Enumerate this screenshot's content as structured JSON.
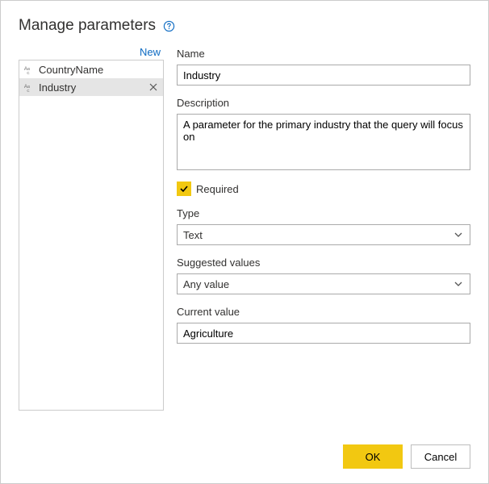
{
  "header": {
    "title": "Manage parameters"
  },
  "sidebar": {
    "new_label": "New",
    "items": [
      {
        "label": "CountryName",
        "selected": false
      },
      {
        "label": "Industry",
        "selected": true
      }
    ]
  },
  "form": {
    "name_label": "Name",
    "name_value": "Industry",
    "description_label": "Description",
    "description_value": "A parameter for the primary industry that the query will focus on",
    "required_label": "Required",
    "required_checked": true,
    "type_label": "Type",
    "type_value": "Text",
    "suggested_label": "Suggested values",
    "suggested_value": "Any value",
    "current_label": "Current value",
    "current_value": "Agriculture"
  },
  "buttons": {
    "ok": "OK",
    "cancel": "Cancel"
  }
}
